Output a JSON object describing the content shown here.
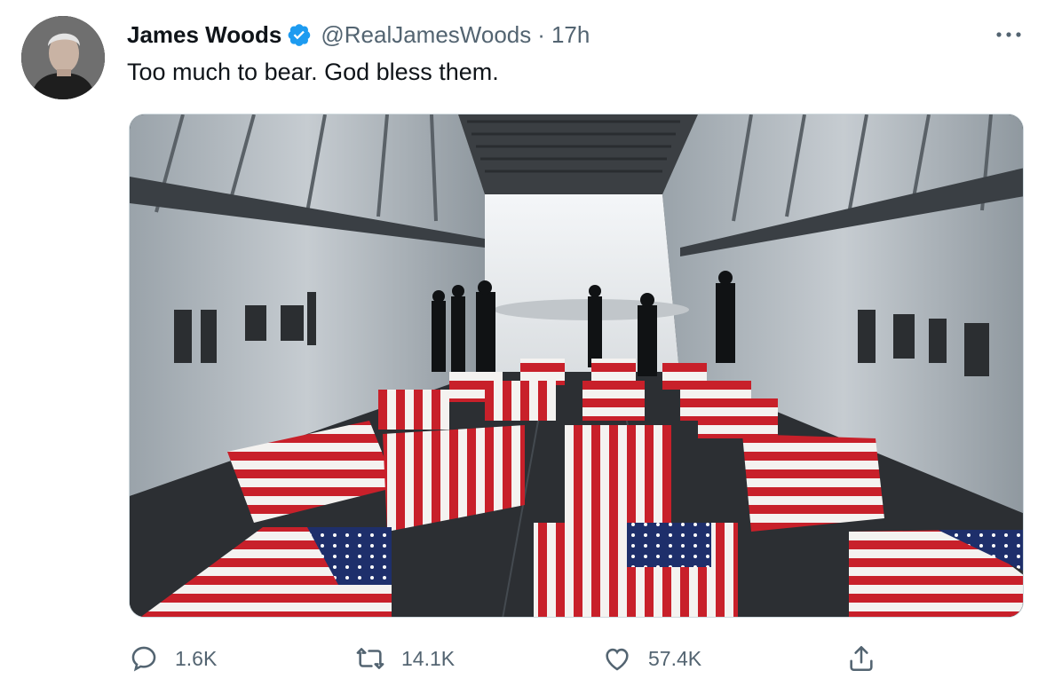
{
  "tweet": {
    "author_name": "James Woods",
    "handle": "@RealJamesWoods",
    "separator": "·",
    "time": "17h",
    "text": "Too much to bear. God bless them.",
    "verified": true
  },
  "media": {
    "icon": "photo"
  },
  "actions": {
    "reply_count": "1.6K",
    "retweet_count": "14.1K",
    "like_count": "57.4K"
  },
  "colors": {
    "text_primary": "#0f1419",
    "text_secondary": "#536471",
    "verified_blue": "#1d9bf0",
    "border": "#cfd9de"
  }
}
